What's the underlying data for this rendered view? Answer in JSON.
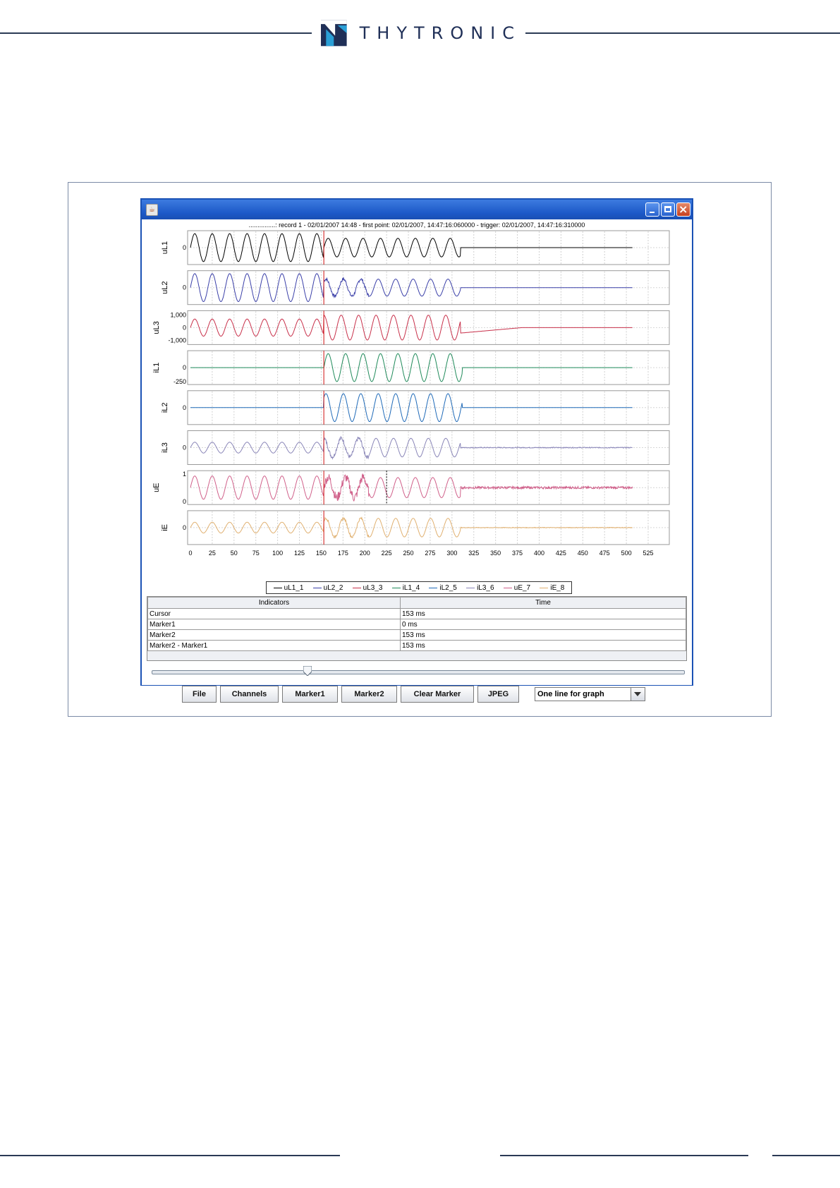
{
  "brand": {
    "name": "THYTRONIC"
  },
  "window": {
    "record_title": "...............: record 1 - 02/01/2007 14:48 - first point: 02/01/2007, 14:47:16:060000 - trigger: 02/01/2007, 14:47:16:310000"
  },
  "chart_data": {
    "type": "line",
    "x_axis": {
      "min": 0,
      "max": 525,
      "ticks": [
        0,
        25,
        50,
        75,
        100,
        125,
        150,
        175,
        200,
        225,
        250,
        275,
        300,
        325,
        350,
        375,
        400,
        425,
        450,
        475,
        500,
        525
      ]
    },
    "cursor_x": 153,
    "marker2_x": 225,
    "end_x": 507,
    "series": [
      {
        "name": "uL1_1",
        "ylabel": "uL1",
        "color": "#000000",
        "yticks": [
          "0"
        ],
        "pre_amp": 0.9,
        "fault_amp": 0.6,
        "fault_end": 310,
        "post": "flat",
        "noise": 0
      },
      {
        "name": "uL2_2",
        "ylabel": "uL2",
        "color": "#3a3fa8",
        "yticks": [
          "0"
        ],
        "pre_amp": 0.9,
        "fault_amp": 0.55,
        "fault_end": 310,
        "post": "flat",
        "noise": 0.05
      },
      {
        "name": "uL3_3",
        "ylabel": "uL3",
        "color": "#c8304a",
        "yticks": [
          "1,000",
          "0",
          "-1,000"
        ],
        "pre_amp": 0.55,
        "fault_amp": 0.8,
        "fault_end": 310,
        "post": "recover",
        "noise": 0
      },
      {
        "name": "iL1_4",
        "ylabel": "iL1",
        "color": "#1f8a5a",
        "yticks": [
          "0",
          "-250"
        ],
        "pre_amp": 0,
        "fault_amp": 0.9,
        "fault_end": 312,
        "post": "flat",
        "noise": 0
      },
      {
        "name": "iL2_5",
        "ylabel": "iL2",
        "color": "#1f6ab8",
        "yticks": [
          "0"
        ],
        "pre_amp": 0,
        "fault_amp": 0.9,
        "fault_end": 312,
        "post": "flat",
        "noise": 0
      },
      {
        "name": "iL3_6",
        "ylabel": "iL3",
        "color": "#8a86b8",
        "yticks": [
          "0"
        ],
        "pre_amp": 0.35,
        "fault_amp": 0.6,
        "fault_end": 310,
        "post": "noise",
        "noise": 0.06
      },
      {
        "name": "uE_7",
        "ylabel": "uE",
        "color": "#d0608a",
        "yticks": [
          "1",
          "0"
        ],
        "pre_amp": 0.75,
        "fault_amp": 0.65,
        "fault_end": 310,
        "post": "noise",
        "noise": 0.15
      },
      {
        "name": "iE_8",
        "ylabel": "iE",
        "color": "#e0b070",
        "yticks": [
          "0"
        ],
        "pre_amp": 0.35,
        "fault_amp": 0.6,
        "fault_end": 310,
        "post": "noise",
        "noise": 0.04
      }
    ]
  },
  "indicators": {
    "header_indicators": "Indicators",
    "header_time": "Time",
    "rows": [
      {
        "label": "Cursor",
        "time": "153 ms"
      },
      {
        "label": "Marker1",
        "time": "0 ms"
      },
      {
        "label": "Marker2",
        "time": "153 ms"
      },
      {
        "label": "Marker2 - Marker1",
        "time": "153 ms"
      }
    ]
  },
  "slider": {
    "position": 0.3
  },
  "buttons": {
    "file": "File",
    "channels": "Channels",
    "marker1": "Marker1",
    "marker2": "Marker2",
    "clear_marker": "Clear Marker",
    "jpeg": "JPEG"
  },
  "view_select": {
    "value": "One line for graph"
  }
}
